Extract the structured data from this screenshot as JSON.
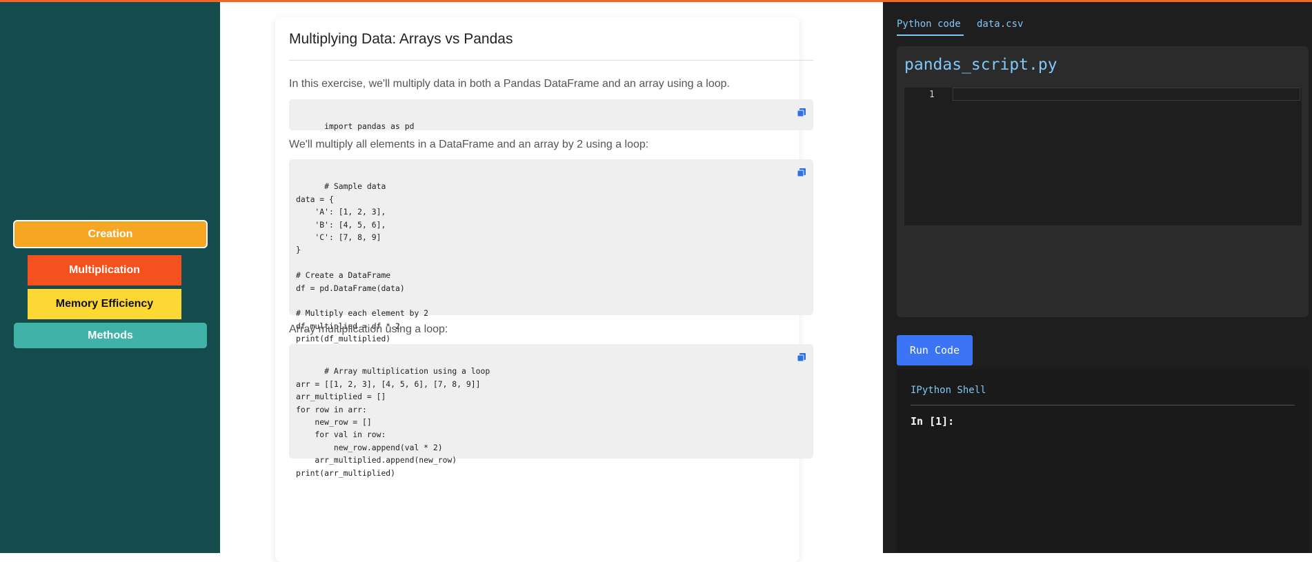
{
  "sidebar": {
    "items": [
      {
        "label": "Creation",
        "color": "#f5a623"
      },
      {
        "label": "Multiplication",
        "color": "#f4511e"
      },
      {
        "label": "Memory Efficiency",
        "color": "#fdd835"
      },
      {
        "label": "Methods",
        "color": "#40b2a8"
      }
    ]
  },
  "lesson": {
    "title": "Multiplying Data: Arrays vs Pandas",
    "intro": "In this exercise, we'll multiply data in both a Pandas DataFrame and an array using a loop.",
    "code1": "import pandas as pd",
    "para2": "We'll multiply all elements in a DataFrame and an array by 2 using a loop:",
    "code2": "# Sample data\ndata = {\n    'A': [1, 2, 3],\n    'B': [4, 5, 6],\n    'C': [7, 8, 9]\n}\n\n# Create a DataFrame\ndf = pd.DataFrame(data)\n\n# Multiply each element by 2\ndf_multiplied = df * 2\nprint(df_multiplied)",
    "para3": "Array multiplication using a loop:",
    "code3": "# Array multiplication using a loop\narr = [[1, 2, 3], [4, 5, 6], [7, 8, 9]]\narr_multiplied = []\nfor row in arr:\n    new_row = []\n    for val in row:\n        new_row.append(val * 2)\n    arr_multiplied.append(new_row)\nprint(arr_multiplied)",
    "copy_icon": "copy-icon"
  },
  "editor": {
    "tabs": [
      {
        "label": "Python code",
        "active": true
      },
      {
        "label": "data.csv",
        "active": false
      }
    ],
    "filename": "pandas_script.py",
    "line_number": "1",
    "run_label": "Run Code"
  },
  "shell": {
    "title": "IPython Shell",
    "prompt": "In [1]:"
  },
  "colors": {
    "accent": "#f26522",
    "sidebar_bg": "#144b4d",
    "link_blue": "#7fc8f8",
    "run_button": "#3b74f5"
  }
}
